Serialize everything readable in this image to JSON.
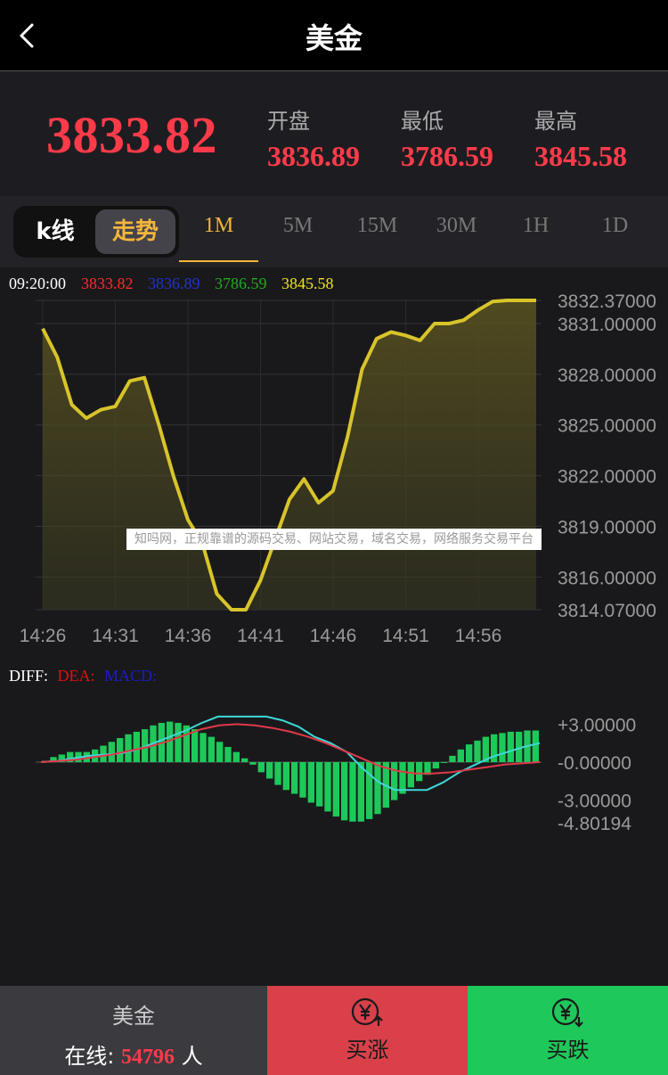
{
  "header": {
    "title": "美金"
  },
  "quote": {
    "price": "3833.82",
    "open_label": "开盘",
    "open": "3836.89",
    "low_label": "最低",
    "low": "3786.59",
    "high_label": "最高",
    "high": "3845.58"
  },
  "tabs": {
    "kline": "k线",
    "trend": "走势",
    "periods": [
      "1M",
      "5M",
      "15M",
      "30M",
      "1H",
      "1D"
    ],
    "active_period": "1M"
  },
  "legend": {
    "time": "09:20:00",
    "v1": "3833.82",
    "v2": "3836.89",
    "v3": "3786.59",
    "v4": "3845.58"
  },
  "watermark": "知吗网，正规靠谱的源码交易、网站交易，域名交易，网络服务交易平台",
  "macd_legend": {
    "diff": "DIFF:",
    "dea": "DEA:",
    "macd": "MACD:"
  },
  "colors": {
    "up": "#ff3b4a",
    "down": "#1ec85a",
    "accent": "#f3b63c",
    "price_line": "#d8c42a",
    "diff_line": "#3fd8d8",
    "dea_line": "#e0394a"
  },
  "chart_data": [
    {
      "type": "area",
      "x_ticks": [
        "14:26",
        "14:31",
        "14:36",
        "14:41",
        "14:46",
        "14:51",
        "14:56"
      ],
      "y_ticks": [
        "3832.37000",
        "3831.00000",
        "3828.00000",
        "3825.00000",
        "3822.00000",
        "3819.00000",
        "3816.00000",
        "3814.07000"
      ],
      "ylim": [
        3814.07,
        3832.37
      ],
      "x": [
        "14:26",
        "14:27",
        "14:28",
        "14:29",
        "14:30",
        "14:31",
        "14:32",
        "14:33",
        "14:34",
        "14:35",
        "14:36",
        "14:37",
        "14:38",
        "14:39",
        "14:40",
        "14:41",
        "14:42",
        "14:43",
        "14:44",
        "14:45",
        "14:46",
        "14:47",
        "14:48",
        "14:49",
        "14:50",
        "14:51",
        "14:52",
        "14:53",
        "14:54",
        "14:55",
        "14:56",
        "14:57",
        "14:58",
        "14:59",
        "15:00"
      ],
      "values": [
        3830.7,
        3829.0,
        3826.2,
        3825.4,
        3825.9,
        3826.1,
        3827.6,
        3827.8,
        3825.0,
        3822.0,
        3819.4,
        3818.0,
        3815.0,
        3814.07,
        3814.07,
        3815.8,
        3818.2,
        3820.6,
        3821.8,
        3820.4,
        3821.1,
        3824.3,
        3828.3,
        3830.1,
        3830.5,
        3830.3,
        3830.0,
        3831.0,
        3831.0,
        3831.2,
        3831.8,
        3832.3,
        3832.37,
        3832.37,
        3832.37
      ],
      "grid": true
    },
    {
      "type": "bar",
      "y_ticks": [
        "+3.00000",
        "-0.00000",
        "-3.00000",
        "-4.80194"
      ],
      "ylim": [
        -4.80194,
        3.0
      ],
      "series": [
        {
          "name": "MACD",
          "values": [
            0.1,
            0.4,
            0.6,
            0.8,
            0.8,
            0.8,
            1.0,
            1.3,
            1.6,
            1.9,
            2.2,
            2.4,
            2.6,
            2.9,
            3.1,
            3.2,
            3.1,
            2.9,
            2.6,
            2.3,
            2.0,
            1.6,
            1.2,
            0.8,
            0.3,
            -0.2,
            -0.8,
            -1.3,
            -1.8,
            -2.2,
            -2.5,
            -2.8,
            -3.2,
            -3.5,
            -3.9,
            -4.3,
            -4.6,
            -4.7,
            -4.7,
            -4.5,
            -4.1,
            -3.6,
            -3.0,
            -2.5,
            -2.0,
            -1.5,
            -1.0,
            -0.5,
            0.0,
            0.5,
            1.0,
            1.4,
            1.7,
            2.0,
            2.2,
            2.3,
            2.4,
            2.4,
            2.5,
            2.5
          ]
        },
        {
          "name": "DIFF",
          "values": [
            0.0,
            0.1,
            0.3,
            0.5,
            0.6,
            0.7,
            1.0,
            1.5,
            2.0,
            2.5,
            3.1,
            3.6,
            3.6,
            3.6,
            3.6,
            3.3,
            2.8,
            2.0,
            1.5,
            0.8,
            -0.5,
            -1.6,
            -2.2,
            -2.2,
            -2.2,
            -1.6,
            -0.8,
            -0.2,
            0.4,
            0.8,
            1.2,
            1.5
          ]
        },
        {
          "name": "DEA",
          "values": [
            0.0,
            0.1,
            0.2,
            0.4,
            0.6,
            0.9,
            1.2,
            1.6,
            2.1,
            2.6,
            2.9,
            3.0,
            2.9,
            2.7,
            2.4,
            2.0,
            1.5,
            0.9,
            0.3,
            -0.3,
            -0.7,
            -0.9,
            -0.9,
            -0.8,
            -0.6,
            -0.4,
            -0.2,
            -0.1,
            0.0
          ]
        }
      ],
      "grid": false
    }
  ],
  "footer": {
    "name": "美金",
    "online_label": "在线: ",
    "online_count": "54796",
    "online_unit": " 人",
    "buy_up": "买涨",
    "buy_down": "买跌"
  }
}
